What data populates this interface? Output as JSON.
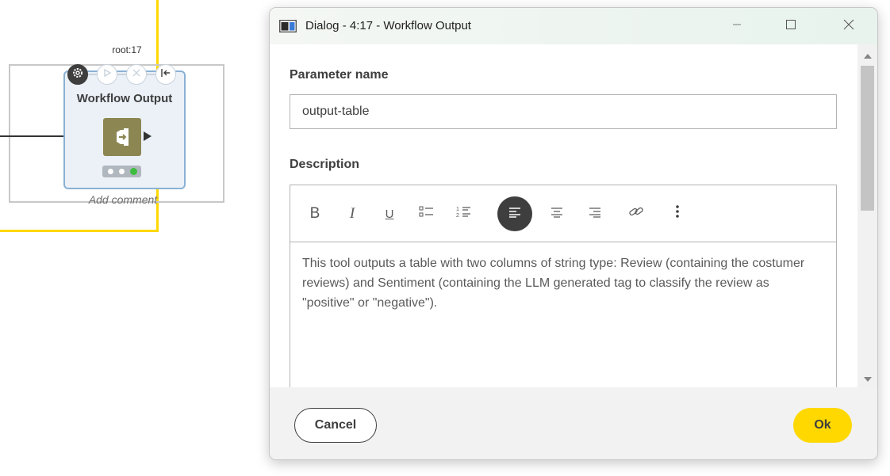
{
  "canvas": {
    "node_id": "root:17",
    "node_title": "Workflow Output",
    "add_comment": "Add comment",
    "node_toolbar": [
      "gear-icon",
      "play-icon",
      "cancel-icon",
      "reset-icon"
    ],
    "node_status": "executed",
    "annotation_color": "#ffd800",
    "node_icon_color": "#8b8652"
  },
  "dialog": {
    "title": "Dialog - 4:17 - Workflow Output",
    "window_controls": [
      "minimize",
      "maximize",
      "close"
    ],
    "parameter_label": "Parameter name",
    "parameter_value": "output-table",
    "description_label": "Description",
    "toolbar": [
      {
        "name": "bold-button",
        "icon": "B"
      },
      {
        "name": "italic-button",
        "icon": "I"
      },
      {
        "name": "underline-button",
        "icon": "U"
      },
      {
        "name": "bullet-list-button",
        "icon": "bullet-list-icon"
      },
      {
        "name": "numbered-list-button",
        "icon": "numbered-list-icon"
      },
      {
        "name": "align-left-button",
        "icon": "align-left-icon",
        "active": true
      },
      {
        "name": "align-center-button",
        "icon": "align-center-icon"
      },
      {
        "name": "align-right-button",
        "icon": "align-right-icon"
      },
      {
        "name": "link-button",
        "icon": "link-icon"
      },
      {
        "name": "more-button",
        "icon": "more-vertical-icon"
      }
    ],
    "description_text": "This tool outputs a table with two columns of string type: Review (containing the costumer reviews) and Sentiment (containing the LLM generated tag to classify the review as \"positive\" or \"negative\").",
    "cancel_label": "Cancel",
    "ok_label": "Ok",
    "accent_color": "#ffd800"
  }
}
